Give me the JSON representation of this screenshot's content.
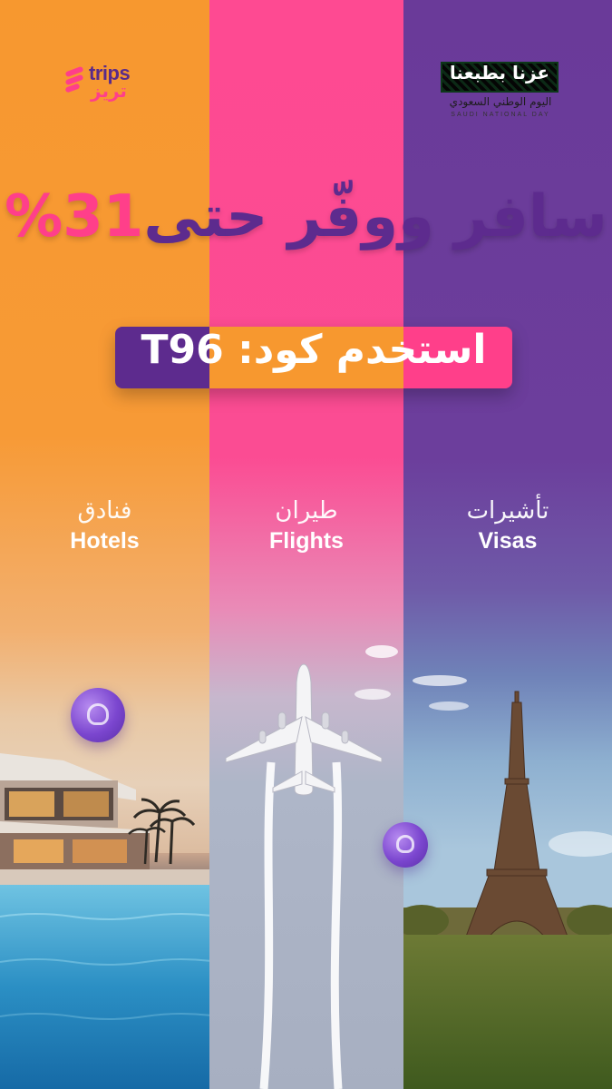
{
  "brand": {
    "name_en": "trips",
    "name_ar": "تريز"
  },
  "national_day": {
    "title": "عزنا بطبعنا",
    "subtitle_ar": "اليوم الوطني السعودي",
    "subtitle_en": "SAUDI NATIONAL DAY"
  },
  "headline": {
    "part1": "سافر ووفّر",
    "part2": "حتى",
    "percent": "31%"
  },
  "promo": {
    "label": "استخدم كود:",
    "code": "T96"
  },
  "services": [
    {
      "ar": "فنادق",
      "en": "Hotels"
    },
    {
      "ar": "طيران",
      "en": "Flights"
    },
    {
      "ar": "تأشيرات",
      "en": "Visas"
    }
  ],
  "colors": {
    "orange": "#f7982f",
    "pink": "#ff3f8a",
    "purple": "#5d2b8e"
  },
  "icons": [
    "trips-logo-icon",
    "coin-icon",
    "airplane-icon",
    "eiffel-tower-icon",
    "villa-icon",
    "palm-tree-icon"
  ]
}
